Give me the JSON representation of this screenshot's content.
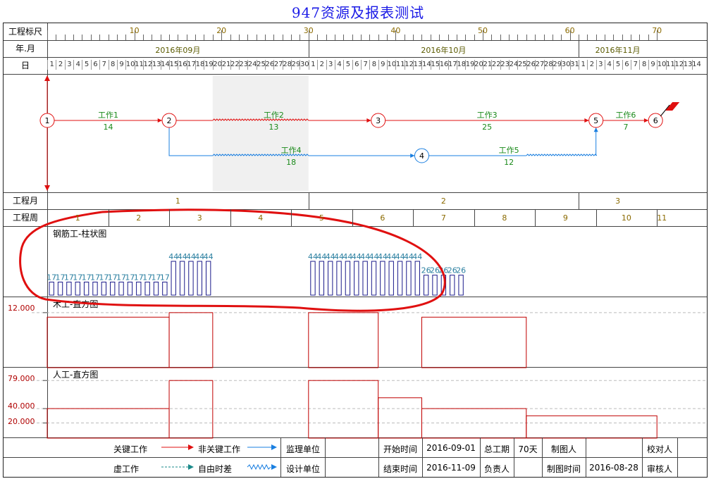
{
  "title": "947资源及报表测试",
  "row_labels": {
    "scale": "工程标尺",
    "year_month": "年.月",
    "day": "日",
    "proj_month": "工程月",
    "proj_week": "工程周"
  },
  "scale_ticks": [
    "10",
    "20",
    "30",
    "40",
    "50",
    "60",
    "70"
  ],
  "months": [
    "2016年09月",
    "2016年10月",
    "2016年11月"
  ],
  "days": {
    "sep": [
      "1",
      "2",
      "3",
      "4",
      "5",
      "6",
      "7",
      "8",
      "9",
      "10",
      "11",
      "12",
      "13",
      "14",
      "15",
      "16",
      "17",
      "18",
      "19",
      "20",
      "21",
      "22",
      "23",
      "24",
      "25",
      "26",
      "27",
      "28",
      "29",
      "30"
    ],
    "oct": [
      "1",
      "2",
      "3",
      "4",
      "5",
      "6",
      "7",
      "8",
      "9",
      "10",
      "11",
      "12",
      "13",
      "14",
      "15",
      "16",
      "17",
      "18",
      "19",
      "20",
      "21",
      "22",
      "23",
      "24",
      "25",
      "26",
      "27",
      "28",
      "29",
      "30",
      "31"
    ],
    "nov": [
      "1",
      "2",
      "3",
      "4",
      "5",
      "6",
      "7",
      "8",
      "9",
      "10",
      "11",
      "12",
      "13",
      "14"
    ]
  },
  "network": {
    "nodes": [
      "1",
      "2",
      "3",
      "4",
      "5",
      "6"
    ],
    "tasks": [
      {
        "name": "工作1",
        "duration": "14"
      },
      {
        "name": "工作2",
        "duration": "13"
      },
      {
        "name": "工作3",
        "duration": "25"
      },
      {
        "name": "工作4",
        "duration": "18"
      },
      {
        "name": "工作5",
        "duration": "12"
      },
      {
        "name": "工作6",
        "duration": "7"
      }
    ],
    "colors": {
      "critical": "#e01010",
      "noncritical": "#1a7fe0",
      "task_label": "#1a8a1a"
    }
  },
  "proj_months": [
    "1",
    "2",
    "3"
  ],
  "proj_weeks": [
    "1",
    "2",
    "3",
    "4",
    "5",
    "6",
    "7",
    "8",
    "9",
    "10",
    "11"
  ],
  "charts": [
    {
      "label": "钢筋工-柱状图",
      "chart_data": {
        "type": "bar",
        "segments": [
          {
            "from_day": 1,
            "to_day": 14,
            "value": 17
          },
          {
            "from_day": 15,
            "to_day": 19,
            "value": 44
          },
          {
            "from_day": 31,
            "to_day": 43,
            "value": 44
          },
          {
            "from_day": 44,
            "to_day": 48,
            "value": 26
          }
        ],
        "bar_label_texts": [
          "17",
          "44",
          "44",
          "26"
        ]
      }
    },
    {
      "label": "木工-直方图",
      "y_labels": [
        "12.000"
      ],
      "chart_data": {
        "type": "area",
        "ylim": [
          0,
          14
        ],
        "steps": [
          {
            "from_day": 0,
            "to_day": 14,
            "value": 11
          },
          {
            "from_day": 14,
            "to_day": 19,
            "value": 12
          },
          {
            "from_day": 19,
            "to_day": 30,
            "value": 0
          },
          {
            "from_day": 30,
            "to_day": 38,
            "value": 12
          },
          {
            "from_day": 38,
            "to_day": 43,
            "value": 0
          },
          {
            "from_day": 43,
            "to_day": 55,
            "value": 11
          },
          {
            "from_day": 55,
            "to_day": 70,
            "value": 0
          }
        ]
      }
    },
    {
      "label": "人工-直方图",
      "y_labels": [
        "79.000",
        "40.000",
        "20.000"
      ],
      "chart_data": {
        "type": "area",
        "ylim": [
          0,
          88
        ],
        "steps": [
          {
            "from_day": 0,
            "to_day": 14,
            "value": 40
          },
          {
            "from_day": 14,
            "to_day": 19,
            "value": 79
          },
          {
            "from_day": 19,
            "to_day": 30,
            "value": 0
          },
          {
            "from_day": 30,
            "to_day": 38,
            "value": 79
          },
          {
            "from_day": 38,
            "to_day": 43,
            "value": 55
          },
          {
            "from_day": 43,
            "to_day": 55,
            "value": 40
          },
          {
            "from_day": 55,
            "to_day": 70,
            "value": 30
          }
        ]
      }
    }
  ],
  "legend": {
    "critical": "关键工作",
    "noncritical": "非关键工作",
    "dummy": "虚工作",
    "float": "自由时差"
  },
  "info": {
    "supervisor": "监理单位",
    "designer": "设计单位",
    "start_label": "开始时间",
    "start_value": "2016-09-01",
    "end_label": "结束时间",
    "end_value": "2016-11-09",
    "total_label": "总工期",
    "total_value": "70天",
    "owner_label": "负责人",
    "drawer_label": "制图人",
    "drawtime_label": "制图时间",
    "drawtime_value": "2016-08-28",
    "checker_label": "校对人",
    "reviewer_label": "审核人"
  }
}
